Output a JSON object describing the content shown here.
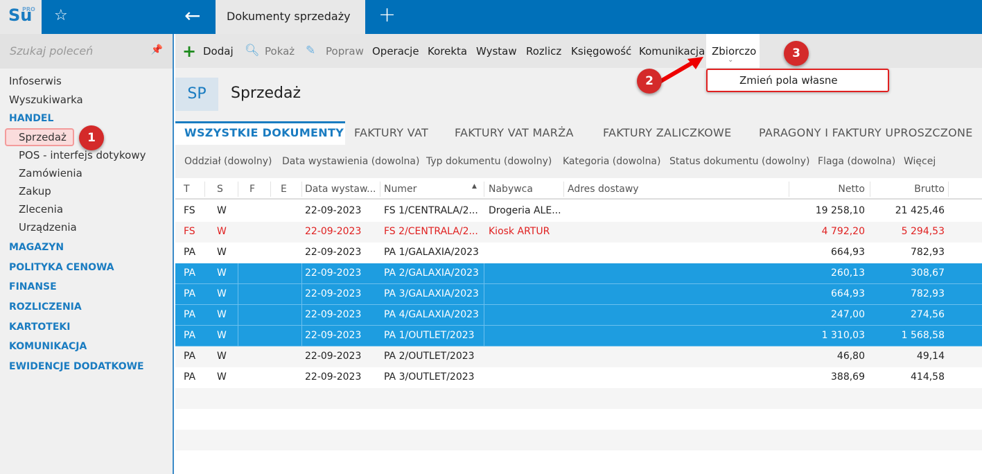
{
  "topbar": {
    "logo": "Su",
    "logo_sup": "PRO",
    "tab_title": "Dokumenty sprzedaży"
  },
  "sidebar": {
    "search_placeholder": "Szukaj poleceń",
    "items": [
      {
        "label": "Infoserwis",
        "type": "item"
      },
      {
        "label": "Wyszukiwarka",
        "type": "item"
      },
      {
        "label": "HANDEL",
        "type": "section"
      },
      {
        "label": "Sprzedaż",
        "type": "sub",
        "selected": true
      },
      {
        "label": "POS - interfejs dotykowy",
        "type": "sub"
      },
      {
        "label": "Zamówienia",
        "type": "sub"
      },
      {
        "label": "Zakup",
        "type": "sub"
      },
      {
        "label": "Zlecenia",
        "type": "sub"
      },
      {
        "label": "Urządzenia",
        "type": "sub"
      },
      {
        "label": "MAGAZYN",
        "type": "section"
      },
      {
        "label": "POLITYKA CENOWA",
        "type": "section"
      },
      {
        "label": "FINANSE",
        "type": "section"
      },
      {
        "label": "ROZLICZENIA",
        "type": "section"
      },
      {
        "label": "KARTOTEKI",
        "type": "section"
      },
      {
        "label": "KOMUNIKACJA",
        "type": "section"
      },
      {
        "label": "EWIDENCJE DODATKOWE",
        "type": "section"
      }
    ]
  },
  "toolbar": {
    "items": [
      "Dodaj",
      "Pokaż",
      "Popraw",
      "Operacje",
      "Korekta",
      "Wystaw",
      "Rozlicz",
      "Księgowość",
      "Komunikacja",
      "Zbiorczo"
    ]
  },
  "dropdown": {
    "item": "Zmień pola własne"
  },
  "annotations": [
    "1",
    "2",
    "3"
  ],
  "page": {
    "badge": "SP",
    "title": "Sprzedaż"
  },
  "tabs": [
    "WSZYSTKIE DOKUMENTY",
    "FAKTURY VAT",
    "FAKTURY VAT MARŻA",
    "FAKTURY ZALICZKOWE",
    "PARAGONY I FAKTURY UPROSZCZONE"
  ],
  "filters": [
    "Oddział (dowolny)",
    "Data wystawienia (dowolna)",
    "Typ dokumentu (dowolny)",
    "Kategoria (dowolna)",
    "Status dokumentu (dowolny)",
    "Flaga (dowolna)",
    "Więcej"
  ],
  "colors": {
    "accent": "#0070b9",
    "selected_row": "#1e9de0",
    "red_text": "#e02020"
  },
  "table": {
    "columns": [
      "T",
      "S",
      "F",
      "E",
      "Data wystaw...",
      "Numer",
      "Nabywca",
      "Adres dostawy",
      "Netto",
      "Brutto"
    ],
    "sort": "Numer ascending",
    "rows": [
      [
        "FS",
        "W",
        "",
        "",
        "22-09-2023",
        "FS 1/CENTRALA/2...",
        "Drogeria ALE...",
        "",
        "19 258,10",
        "21 425,46"
      ],
      [
        "FS",
        "W",
        "",
        "",
        "22-09-2023",
        "FS 2/CENTRALA/2...",
        "Kiosk ARTUR",
        "",
        "4 792,20",
        "5 294,53"
      ],
      [
        "PA",
        "W",
        "",
        "",
        "22-09-2023",
        "PA 1/GALAXIA/2023",
        "",
        "",
        "664,93",
        "782,93"
      ],
      [
        "PA",
        "W",
        "",
        "",
        "22-09-2023",
        "PA 2/GALAXIA/2023",
        "",
        "",
        "260,13",
        "308,67"
      ],
      [
        "PA",
        "W",
        "",
        "",
        "22-09-2023",
        "PA 3/GALAXIA/2023",
        "",
        "",
        "664,93",
        "782,93"
      ],
      [
        "PA",
        "W",
        "",
        "",
        "22-09-2023",
        "PA 4/GALAXIA/2023",
        "",
        "",
        "247,00",
        "274,56"
      ],
      [
        "PA",
        "W",
        "",
        "",
        "22-09-2023",
        "PA 1/OUTLET/2023",
        "",
        "",
        "1 310,03",
        "1 568,58"
      ],
      [
        "PA",
        "W",
        "",
        "",
        "22-09-2023",
        "PA 2/OUTLET/2023",
        "",
        "",
        "46,80",
        "49,14"
      ],
      [
        "PA",
        "W",
        "",
        "",
        "22-09-2023",
        "PA 3/OUTLET/2023",
        "",
        "",
        "388,69",
        "414,58"
      ]
    ],
    "selected_rows": [
      3,
      4,
      5,
      6
    ],
    "red_rows": [
      1
    ]
  }
}
